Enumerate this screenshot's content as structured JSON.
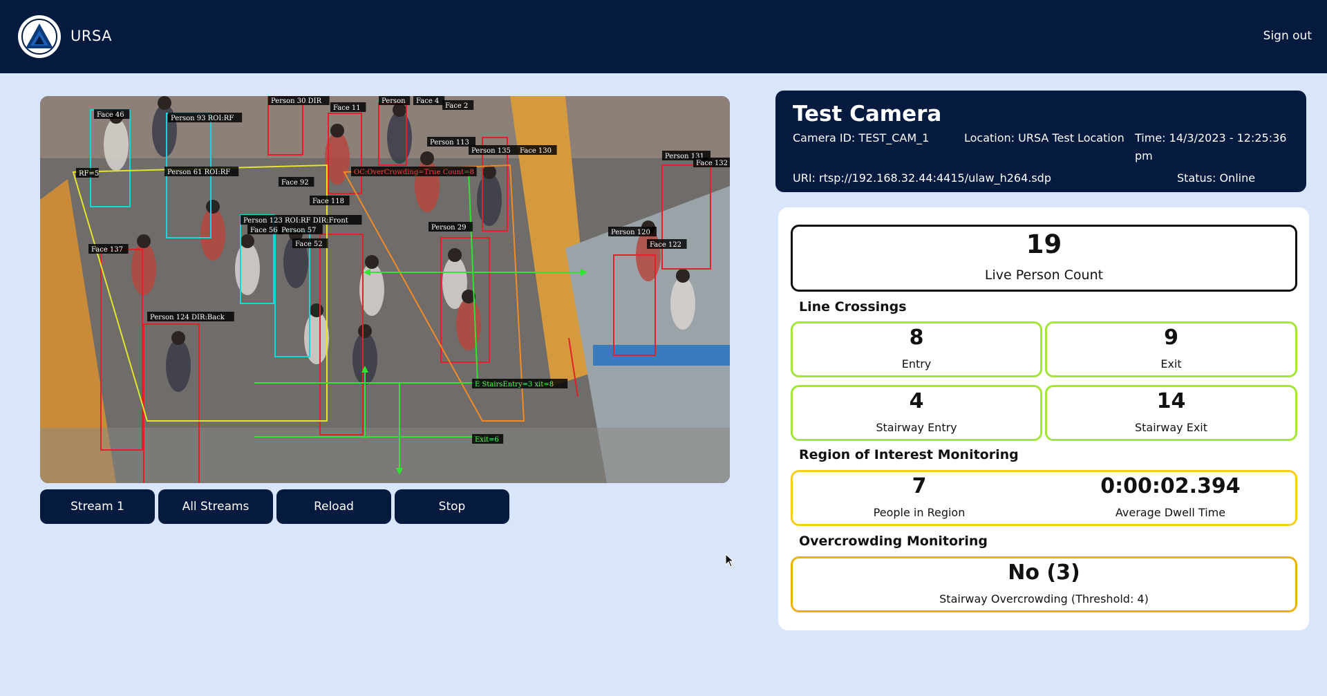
{
  "app": {
    "brand": "URSA",
    "sign_out": "Sign out"
  },
  "video": {
    "overlay_labels": [
      "Face 46",
      "Person 93 ROI:RF",
      "RF=5",
      "Person 61 ROI:RF",
      "Face 137",
      "Person 124 DIR:Back",
      "Person 30 DIR",
      "Face 11",
      "Person",
      "Face 4",
      "Face 2",
      "Person 113",
      "Person 135",
      "Face 130",
      "OC:OverCrowding=True Count=8",
      "Face 92",
      "Face 118",
      "Person 123 ROI:RF DIR:Front",
      "Face 56",
      "Person 57",
      "Face 52",
      "Person 29",
      "Person 120",
      "Face 122",
      "Person 131",
      "Face 132",
      "E StairsEntry=3 xit=8",
      "Exit=6"
    ]
  },
  "controls": {
    "buttons": [
      "Stream 1",
      "All Streams",
      "Reload",
      "Stop"
    ]
  },
  "camera": {
    "title": "Test Camera",
    "id": "Camera ID: TEST_CAM_1",
    "location": "Location: URSA Test Location",
    "time_line1": "Time: 14/3/2023 - 12:25:36",
    "time_line2": "pm",
    "uri": "URI: rtsp://192.168.32.44:4415/ulaw_h264.sdp",
    "status": "Status: Online"
  },
  "stats": {
    "live_count": {
      "value": "19",
      "label": "Live Person Count"
    },
    "line_crossings_title": "Line Crossings",
    "entry": {
      "value": "8",
      "label": "Entry"
    },
    "exit": {
      "value": "9",
      "label": "Exit"
    },
    "stair_entry": {
      "value": "4",
      "label": "Stairway Entry"
    },
    "stair_exit": {
      "value": "14",
      "label": "Stairway Exit"
    },
    "roi_title": "Region of Interest Monitoring",
    "people_in_region": {
      "value": "7",
      "label": "People in Region"
    },
    "dwell_time": {
      "value": "0:00:02.394",
      "label": "Average Dwell Time"
    },
    "overcrowding_title": "Overcrowding Monitoring",
    "overcrowding": {
      "value": "No (3)",
      "label": "Stairway Overcrowding (Threshold: 4)"
    }
  },
  "colors": {
    "navy": "#041a3f",
    "page_bg": "#d9e5fb",
    "green_border": "#a3e635",
    "yellow_border": "#facc15",
    "orange_border": "#eab308"
  }
}
